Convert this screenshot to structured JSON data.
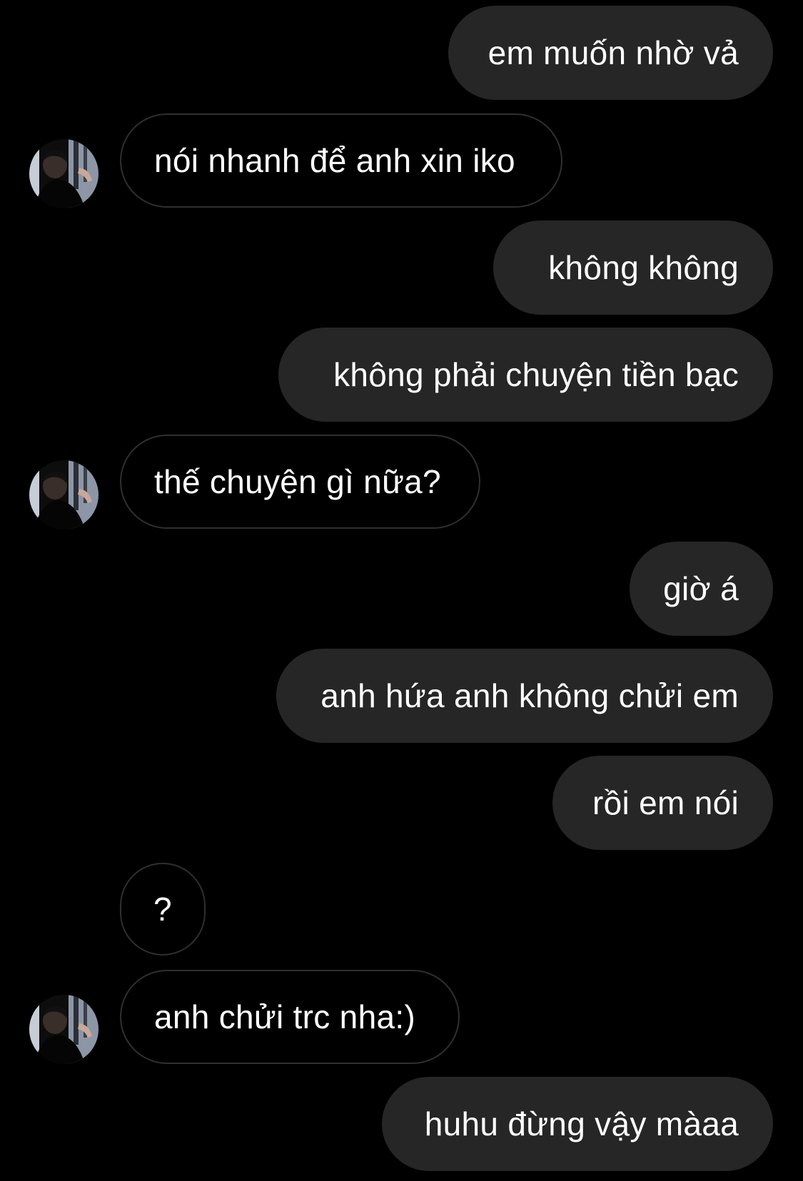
{
  "thread": {
    "messages": [
      {
        "sender": "me",
        "text": "em muốn nhờ vả"
      },
      {
        "sender": "them",
        "text": "nói nhanh để anh xin iko",
        "avatar": "profile-photo"
      },
      {
        "sender": "me",
        "text": "không không"
      },
      {
        "sender": "me",
        "text": "không phải chuyện tiền bạc"
      },
      {
        "sender": "them",
        "text": "thế chuyện gì nữa?",
        "avatar": "profile-photo"
      },
      {
        "sender": "me",
        "text": "giờ á"
      },
      {
        "sender": "me",
        "text": "anh hứa anh không chửi em"
      },
      {
        "sender": "me",
        "text": "rồi em nói"
      },
      {
        "sender": "them",
        "text": "?"
      },
      {
        "sender": "them",
        "text": "anh chửi trc nha:)",
        "avatar": "profile-photo"
      },
      {
        "sender": "me",
        "text": "huhu đừng vậy màaa"
      }
    ]
  },
  "colors": {
    "background": "#000000",
    "outgoing_bubble": "#262626",
    "incoming_border": "#2f2f2f",
    "text": "#ffffff"
  }
}
